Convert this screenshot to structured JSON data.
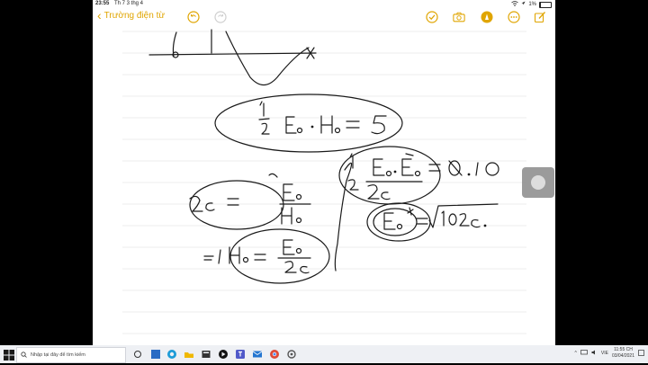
{
  "status_bar": {
    "time": "23:55",
    "date": "Th 7 3 thg 4",
    "battery": "1%",
    "battery_level": 0.01
  },
  "nav": {
    "back_label": "Trường điện từ"
  },
  "colors": {
    "accent": "#e0a500",
    "ink": "#111111",
    "rule": "#d8d8d8"
  },
  "toolbar_icons": [
    "undo-icon",
    "redo-icon",
    "checkmark-icon",
    "camera-icon",
    "pen-marker-icon",
    "more-icon",
    "compose-icon"
  ],
  "taskbar": {
    "search_placeholder": "Nhập tại đây để tìm kiếm",
    "apps": [
      "task-view-icon",
      "edge-icon",
      "file-explorer-icon",
      "store-icon",
      "media-icon",
      "teams-icon",
      "mail-icon",
      "chrome-icon",
      "settings-icon",
      "photos-icon"
    ],
    "lang": "VIE",
    "clock_time": "11:55 CH",
    "clock_date": "03/04/2021"
  }
}
